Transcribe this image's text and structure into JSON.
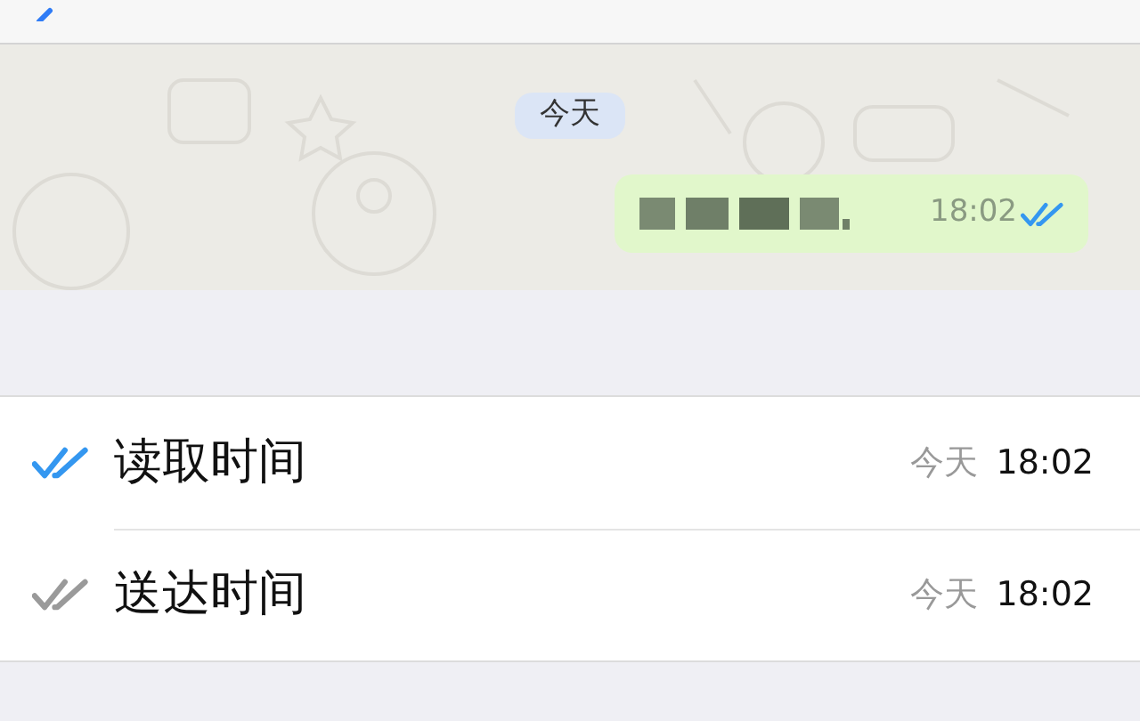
{
  "chat": {
    "date_label": "今天",
    "message": {
      "time": "18:02",
      "read": true
    }
  },
  "receipts": [
    {
      "label": "读取时间",
      "day": "今天",
      "time": "18:02",
      "color": "#3497f0"
    },
    {
      "label": "送达时间",
      "day": "今天",
      "time": "18:02",
      "color": "#9a9a9a"
    }
  ]
}
